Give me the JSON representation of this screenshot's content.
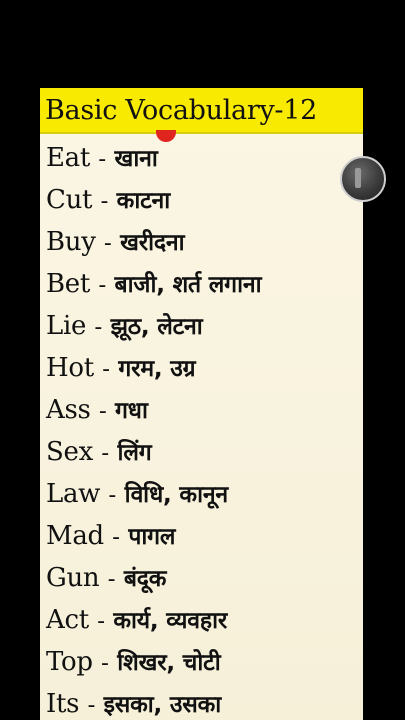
{
  "title": "Basic Vocabulary-12",
  "separator": "-",
  "words": [
    {
      "en": "Eat",
      "hi": "खाना"
    },
    {
      "en": "Cut",
      "hi": "काटना"
    },
    {
      "en": "Buy",
      "hi": "खरीदना"
    },
    {
      "en": "Bet",
      "hi": "बाजी, शर्त लगाना"
    },
    {
      "en": "Lie",
      "hi": "झूठ, लेटना"
    },
    {
      "en": "Hot",
      "hi": "गरम, उग्र"
    },
    {
      "en": "Ass",
      "hi": "गधा"
    },
    {
      "en": "Sex",
      "hi": "लिंग"
    },
    {
      "en": "Law",
      "hi": "विधि, कानून"
    },
    {
      "en": "Mad",
      "hi": "पागल"
    },
    {
      "en": "Gun",
      "hi": "बंदूक"
    },
    {
      "en": "Act",
      "hi": "कार्य, व्यवहार"
    },
    {
      "en": "Top",
      "hi": "शिखर, चोटी"
    },
    {
      "en": "Its",
      "hi": "इसका, उसका"
    }
  ],
  "colors": {
    "background": "#000000",
    "title_bar": "#f8ea00",
    "card": "#fbf6e4",
    "text": "#111111",
    "dot": "#e0241e"
  },
  "icons": {
    "side_button": "round-toggle-icon"
  }
}
